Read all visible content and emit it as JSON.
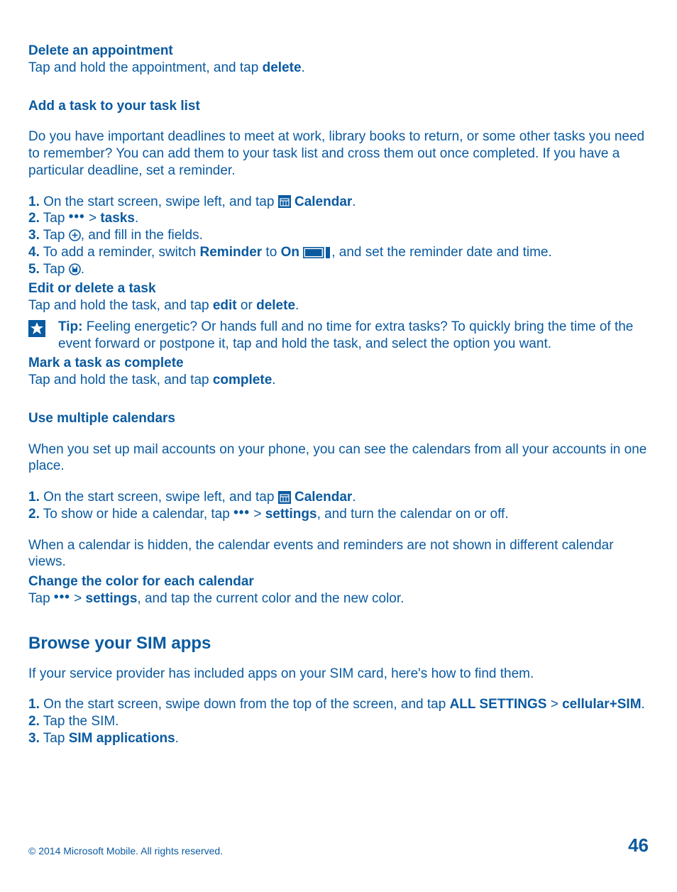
{
  "s1": {
    "title": "Delete an appointment",
    "body_a": "Tap and hold the appointment, and tap ",
    "body_b": "delete",
    "body_c": "."
  },
  "s2": {
    "title": "Add a task to your task list",
    "intro": "Do you have important deadlines to meet at work, library books to return, or some other tasks you need to remember? You can add them to your task list and cross them out once completed. If you have a particular deadline, set a reminder.",
    "l1a": "1.",
    "l1b": " On the start screen, swipe left, and tap ",
    "l1c": "Calendar",
    "l1d": ".",
    "l2a": "2.",
    "l2b": " Tap ",
    "l2c": " > ",
    "l2d": "tasks",
    "l2e": ".",
    "l3a": "3.",
    "l3b": " Tap ",
    "l3c": ", and fill in the fields.",
    "l4a": "4.",
    "l4b": " To add a reminder, switch ",
    "l4c": "Reminder",
    "l4d": " to ",
    "l4e": "On",
    "l4f": " ",
    "l4g": ", and set the reminder date and time.",
    "l5a": "5.",
    "l5b": " Tap ",
    "l5c": "."
  },
  "s3": {
    "title": "Edit or delete a task",
    "body_a": "Tap and hold the task, and tap ",
    "body_b": "edit",
    "body_c": " or ",
    "body_d": "delete",
    "body_e": "."
  },
  "tip": {
    "label": "Tip:",
    "body": " Feeling energetic? Or hands full and no time for extra tasks? To quickly bring the time of the event forward or postpone it, tap and hold the task, and select the option you want."
  },
  "s4": {
    "title": "Mark a task as complete",
    "body_a": "Tap and hold the task, and tap ",
    "body_b": "complete",
    "body_c": "."
  },
  "s5": {
    "title": "Use multiple calendars",
    "intro": "When you set up mail accounts on your phone, you can see the calendars from all your accounts in one place.",
    "l1a": "1.",
    "l1b": " On the start screen, swipe left, and tap ",
    "l1c": "Calendar",
    "l1d": ".",
    "l2a": "2.",
    "l2b": " To show or hide a calendar, tap ",
    "l2c": " > ",
    "l2d": "settings",
    "l2e": ", and turn the calendar on or off.",
    "outro": "When a calendar is hidden, the calendar events and reminders are not shown in different calendar views."
  },
  "s6": {
    "title": "Change the color for each calendar",
    "body_a": "Tap ",
    "body_b": " > ",
    "body_c": "settings",
    "body_d": ", and tap the current color and the new color."
  },
  "s7": {
    "title": "Browse your SIM apps",
    "intro": "If your service provider has included apps on your SIM card, here's how to find them.",
    "l1a": "1.",
    "l1b": " On the start screen, swipe down from the top of the screen, and tap ",
    "l1c": "ALL SETTINGS",
    "l1d": " > ",
    "l1e": "cellular+SIM",
    "l1f": ".",
    "l2a": "2.",
    "l2b": " Tap the SIM.",
    "l3a": "3.",
    "l3b": " Tap ",
    "l3c": "SIM applications",
    "l3d": "."
  },
  "footer": {
    "copyright": "© 2014 Microsoft Mobile. All rights reserved.",
    "page": "46"
  },
  "glyphs": {
    "dots": "•••"
  }
}
